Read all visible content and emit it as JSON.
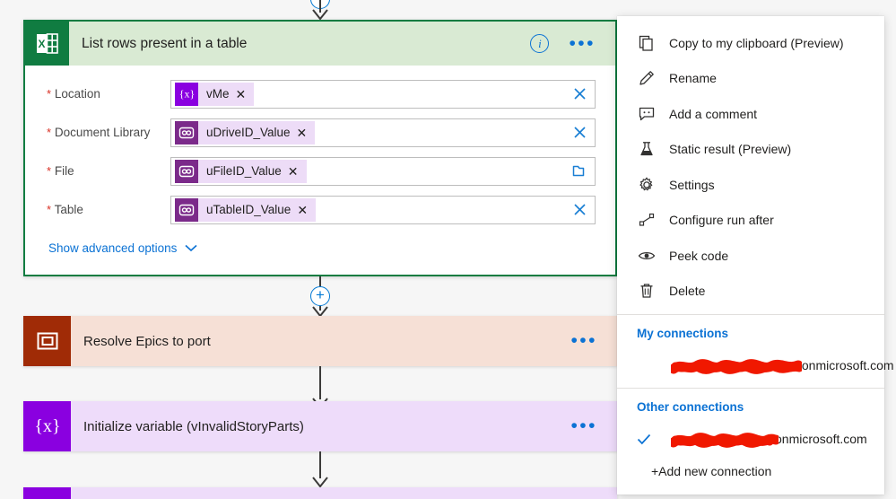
{
  "app": {
    "background": "#f6f6f6",
    "accent_blue": "#0b72d4",
    "excel_green": "#107c41",
    "selected_border": "#107c41"
  },
  "top_connector": {
    "plus_label": "+",
    "name": "add-step-top"
  },
  "selected_card": {
    "icon_name": "excel-icon",
    "title": "List rows present in a table",
    "info_label": "i",
    "more_label": "•••",
    "header_bg": "#d9ead3",
    "icon_bg": "#107c41",
    "fields": [
      {
        "required": true,
        "star": "*",
        "label": "Location",
        "token": {
          "text": "vMe",
          "icon": "variable-icon",
          "icon_kind": "var",
          "remove": "✕"
        },
        "action": "clear",
        "action_icon": "close-icon"
      },
      {
        "required": true,
        "star": "*",
        "label": "Document Library",
        "token": {
          "text": "uDriveID_Value",
          "icon": "compose-icon",
          "icon_kind": "compose",
          "remove": "✕"
        },
        "action": "clear",
        "action_icon": "close-icon"
      },
      {
        "required": true,
        "star": "*",
        "label": "File",
        "token": {
          "text": "uFileID_Value",
          "icon": "compose-icon",
          "icon_kind": "compose",
          "remove": "✕"
        },
        "action": "browse",
        "action_icon": "folder-icon"
      },
      {
        "required": true,
        "star": "*",
        "label": "Table",
        "token": {
          "text": "uTableID_Value",
          "icon": "compose-icon",
          "icon_kind": "compose",
          "remove": "✕"
        },
        "action": "clear",
        "action_icon": "close-icon"
      }
    ],
    "advanced": {
      "label": "Show advanced options",
      "chevron": "chevron-down-icon"
    }
  },
  "mid_connector": {
    "plus_label": "+",
    "name": "add-step-mid"
  },
  "steps": [
    {
      "title": "Resolve Epics to port",
      "icon_name": "scope-icon",
      "icon_bg": "#a02b06",
      "body_bg": "#f6e0d6",
      "more_label": "•••"
    },
    {
      "title": "Initialize variable (vInvalidStoryParts)",
      "icon_name": "variable-icon",
      "icon_bg": "#8a00e0",
      "body_bg": "#eedcfa",
      "more_label": "•••"
    }
  ],
  "partial_step": {
    "icon_name": "variable-icon",
    "icon_bg": "#8a00e0",
    "body_bg": "#eedcfa",
    "title": ""
  },
  "context_menu": {
    "items": [
      {
        "label": "Copy to my clipboard (Preview)",
        "icon": "copy-icon"
      },
      {
        "label": "Rename",
        "icon": "pencil-icon"
      },
      {
        "label": "Add a comment",
        "icon": "comment-icon"
      },
      {
        "label": "Static result (Preview)",
        "icon": "flask-icon"
      },
      {
        "label": "Settings",
        "icon": "gear-icon"
      },
      {
        "label": "Configure run after",
        "icon": "run-after-icon"
      },
      {
        "label": "Peek code",
        "icon": "eye-icon"
      },
      {
        "label": "Delete",
        "icon": "trash-icon"
      }
    ],
    "my_connections_header": "My connections",
    "my_connections": [
      {
        "redacted": true,
        "domain": ".onmicrosoft.com",
        "checked": false
      }
    ],
    "other_connections_header": "Other connections",
    "other_connections": [
      {
        "redacted": true,
        "domain": "onmicrosoft.com",
        "checked": true,
        "check_icon": "check-icon"
      }
    ],
    "add_connection": "+Add new connection",
    "redaction_color": "#f01800"
  }
}
